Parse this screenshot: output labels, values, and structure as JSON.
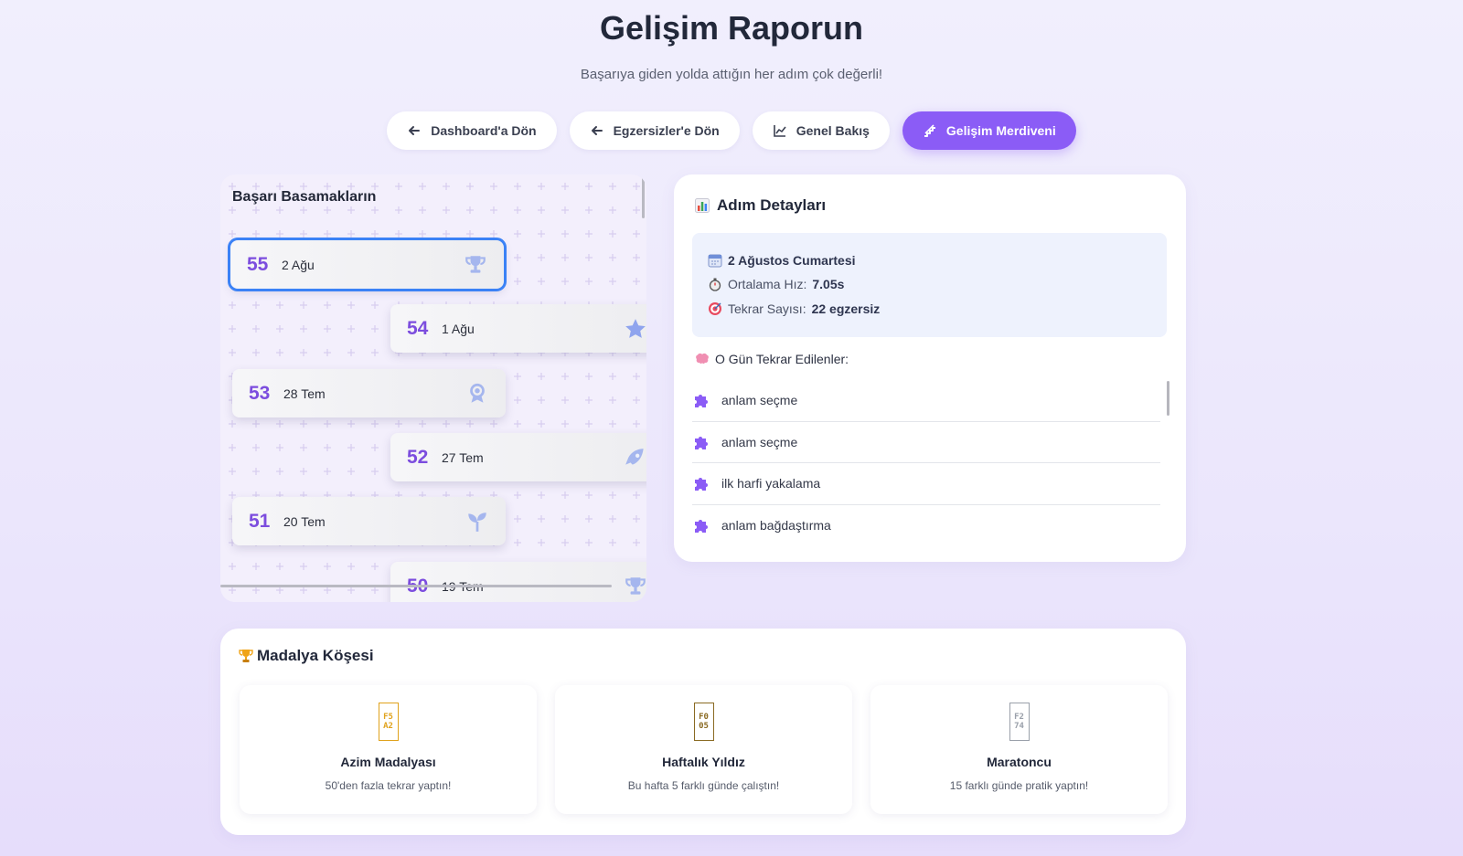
{
  "header": {
    "title": "Gelişim Raporun",
    "subtitle": "Başarıya giden yolda attığın her adım çok değerli!"
  },
  "nav": [
    {
      "label": "Dashboard'a Dön",
      "icon": "arrow-left-icon"
    },
    {
      "label": "Egzersizler'e Dön",
      "icon": "arrow-left-icon"
    },
    {
      "label": "Genel Bakış",
      "icon": "line-chart-icon"
    },
    {
      "label": "Gelişim Merdiveni",
      "icon": "stairs-icon",
      "active": true
    }
  ],
  "ladder": {
    "title": "Başarı Basamakların",
    "steps": [
      {
        "num": "55",
        "date": "2 Ağu",
        "icon": "trophy-icon",
        "selected": true
      },
      {
        "num": "54",
        "date": "1 Ağu",
        "icon": "star-icon"
      },
      {
        "num": "53",
        "date": "28 Tem",
        "icon": "award-icon"
      },
      {
        "num": "52",
        "date": "27 Tem",
        "icon": "rocket-icon"
      },
      {
        "num": "51",
        "date": "20 Tem",
        "icon": "seedling-icon"
      },
      {
        "num": "50",
        "date": "19 Tem",
        "icon": "trophy-icon"
      }
    ]
  },
  "details": {
    "title": "Adım Detayları",
    "date": "2 Ağustos Cumartesi",
    "speed_label": "Ortalama Hız:",
    "speed_value": "7.05s",
    "count_label": "Tekrar Sayısı:",
    "count_value": "22 egzersiz",
    "repeated_label": "O Gün Tekrar Edilenler:",
    "repeated": [
      "anlam seçme",
      "anlam seçme",
      "ilk harfi yakalama",
      "anlam bağdaştırma"
    ]
  },
  "medals": {
    "title": "Madalya Köşesi",
    "items": [
      {
        "glyph": [
          "F5",
          "A2"
        ],
        "name": "Azim Madalyası",
        "desc": "50'den fazla tekrar yaptın!",
        "color": "#e0a21c"
      },
      {
        "glyph": [
          "F0",
          "05"
        ],
        "name": "Haftalık Yıldız",
        "desc": "Bu hafta 5 farklı günde çalıştın!",
        "color": "#8a6a22"
      },
      {
        "glyph": [
          "F2",
          "74"
        ],
        "name": "Maratoncu",
        "desc": "15 farklı günde pratik yaptın!",
        "color": "#9aa0aa"
      }
    ]
  },
  "colors": {
    "accent": "#8b5cf6",
    "step_number": "#7c4dde",
    "selected_outline": "#3b82f6",
    "icon_purple": "#9b7be8"
  }
}
